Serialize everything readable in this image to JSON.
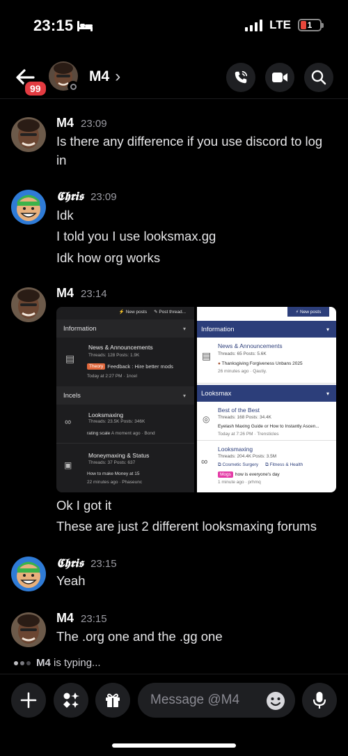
{
  "status_bar": {
    "time": "23:15",
    "network": "LTE",
    "battery": "1"
  },
  "header": {
    "unread_badge": "99",
    "title": "M4",
    "title_chevron": "›"
  },
  "messages": [
    {
      "author": "M4",
      "time": "23:09",
      "lines": [
        "Is there any difference if you use discord to log",
        "in"
      ]
    },
    {
      "author": "𝕮𝖍𝖗𝖎𝖘",
      "time": "23:09",
      "lines": [
        "Idk",
        "I told you I use looksmax.gg",
        "Idk how org works"
      ]
    },
    {
      "author": "M4",
      "time": "23:14",
      "lines": [
        "Ok I got it",
        "These are just 2 different looksmaxing forums"
      ]
    },
    {
      "author": "𝕮𝖍𝖗𝖎𝖘",
      "time": "23:15",
      "lines": [
        "Yeah"
      ]
    },
    {
      "author": "M4",
      "time": "23:15",
      "lines": [
        "The .org one and the .gg one"
      ]
    }
  ],
  "embed": {
    "left": {
      "new_posts": "New posts",
      "post_thread": "Post thread...",
      "section1": "Information",
      "forum1_title": "News & Announcements",
      "forum1_stats": "Threads: 128 Posts: 1.9K",
      "forum1_tag": "Theory",
      "forum1_latest": "Feedback : Hire better mods",
      "forum1_meta": "Today at 2:27 PM · 1ncel",
      "section2": "Incels",
      "forum2_title": "Looksmaxing",
      "forum2_stats": "Threads: 23.5K Posts: 346K",
      "forum2_latest": "rating scale",
      "forum2_meta": "A moment ago · Bond",
      "forum3_title": "Moneymaxing & Status",
      "forum3_stats": "Threads: 37 Posts: 637",
      "forum3_latest": "How to make Money at 15",
      "forum3_meta": "22 minutes ago · Phaseunc"
    },
    "right": {
      "new_posts": "New posts",
      "section1": "Information",
      "forum1_title": "News & Announcements",
      "forum1_stats": "Threads: 65 Posts: 5.6K",
      "forum1_latest": "Thanksgiving Forgiveness Unbans 2025",
      "forum1_meta": "26 minutes ago · Qautiy.",
      "section2": "Looksmax",
      "forum2_title": "Best of the Best",
      "forum2_stats": "Threads: 168 Posts: 34.4K",
      "forum2_latest": "Eyelash Maxing Guide or How to Instantly Ascen...",
      "forum2_meta": "Today at 7:26 PM · Trensticles",
      "forum3_title": "Looksmaxing",
      "forum3_stats": "Threads: 204.4K Posts: 3.5M",
      "forum3_sub1": "Cosmetic Surgery",
      "forum3_sub2": "Fitness & Health",
      "forum3_tag": "Mogs",
      "forum3_latest": "how is everyone's day",
      "forum3_meta": "1 minute ago · prhmq"
    },
    "colors": {
      "right_header": "#2c3e7a",
      "tag_left": "#e2683c",
      "tag_right": "#e43ba6"
    }
  },
  "typing": {
    "name": "M4",
    "text": "is typing..."
  },
  "composer": {
    "placeholder": "Message @M4"
  }
}
